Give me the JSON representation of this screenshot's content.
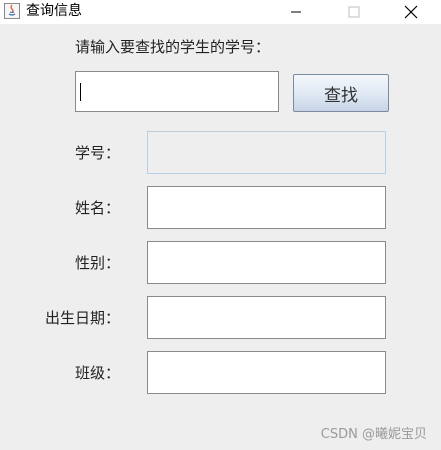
{
  "window": {
    "title": "查询信息",
    "controls": {
      "minimize": "minimize-icon",
      "maximize": "maximize-icon",
      "close": "close-icon"
    },
    "icon": "java-icon"
  },
  "search": {
    "prompt": "请输入要查找的学生的学号：",
    "input_value": "",
    "button_label": "查找"
  },
  "fields": [
    {
      "label": "学号：",
      "value": "",
      "disabled": true
    },
    {
      "label": "姓名：",
      "value": ""
    },
    {
      "label": "性别：",
      "value": ""
    },
    {
      "label": "出生日期：",
      "value": ""
    },
    {
      "label": "班级：",
      "value": ""
    }
  ],
  "watermark": "CSDN @曦妮宝贝",
  "colors": {
    "button_bottom": "#c6d4e6",
    "disabled_border": "#b8cfe3",
    "background": "#eeeeee"
  }
}
